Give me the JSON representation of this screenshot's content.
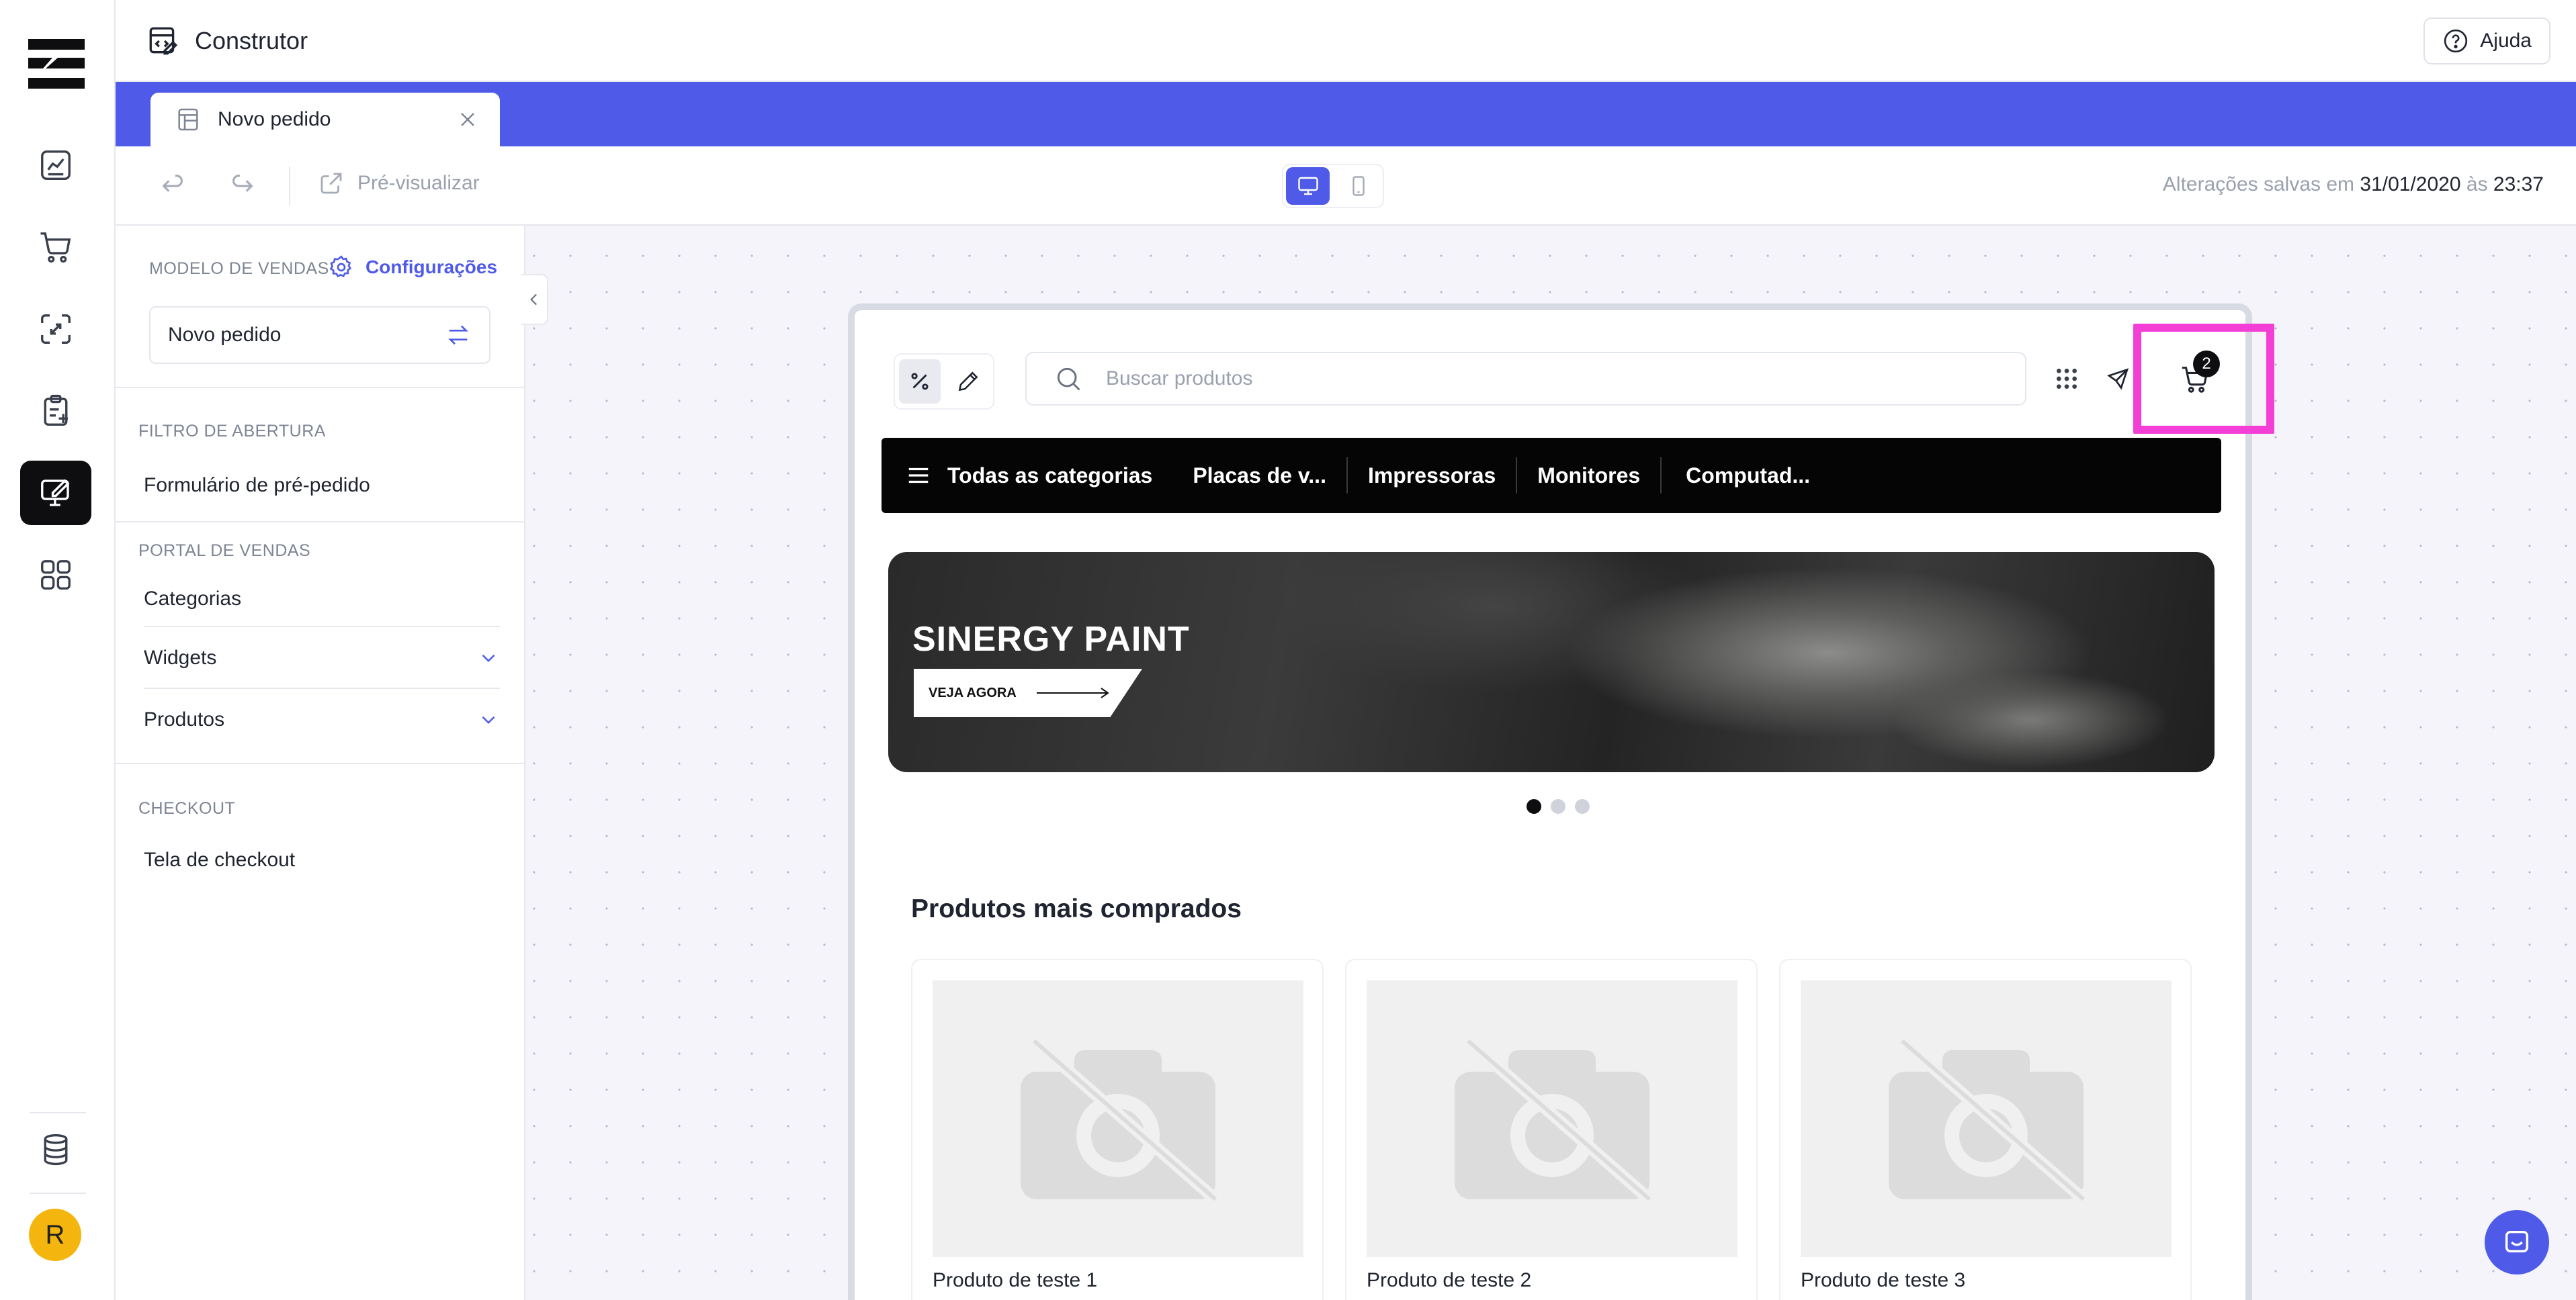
{
  "app": {
    "title": "Construtor",
    "help_label": "Ajuda",
    "avatar_initial": "R"
  },
  "tabs": [
    {
      "label": "Novo pedido",
      "active": true
    }
  ],
  "toolbar": {
    "preview_label": "Pré-visualizar",
    "saved_prefix": "Alterações salvas em",
    "saved_date": "31/01/2020",
    "saved_connector": "às",
    "saved_time": "23:37",
    "device_selected": "desktop"
  },
  "panel": {
    "model_label": "MODELO DE VENDAS",
    "config_label": "Configurações",
    "model_value": "Novo pedido",
    "filter_section": "FILTRO DE ABERTURA",
    "filter_item": "Formulário de pré-pedido",
    "portal_section": "PORTAL DE VENDAS",
    "portal_items": [
      "Categorias",
      "Widgets",
      "Produtos"
    ],
    "checkout_section": "CHECKOUT",
    "checkout_item": "Tela de checkout"
  },
  "store": {
    "search_placeholder": "Buscar produtos",
    "cart_count": "2",
    "categories": [
      "Todas as categorias",
      "Placas de v...",
      "Impressoras",
      "Monitores",
      "Computad..."
    ],
    "banner": {
      "title": "SINERGY PAINT",
      "cta": "VEJA AGORA",
      "slides": 3,
      "active_slide": 1
    },
    "section_title": "Produtos mais comprados",
    "products": [
      "Produto de teste 1",
      "Produto de teste 2",
      "Produto de teste 3"
    ]
  },
  "colors": {
    "accent": "#4f5be8",
    "highlight": "#f43fd6",
    "avatar": "#f5b50f",
    "nav_dark": "#050505"
  },
  "icons": {
    "rail": [
      "dashboard-icon",
      "cart-icon",
      "exchange-icon",
      "clipboard-add-icon",
      "builder-icon",
      "apps-grid-icon",
      "database-icon"
    ]
  }
}
